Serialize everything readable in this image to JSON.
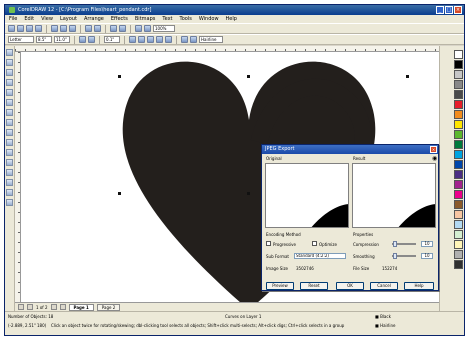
{
  "window": {
    "title": "CorelDRAW 12 - [C:\\Program Files\\heart_pendant.cdr]"
  },
  "menubar": {
    "items": [
      "File",
      "Edit",
      "View",
      "Layout",
      "Arrange",
      "Effects",
      "Bitmaps",
      "Text",
      "Tools",
      "Window",
      "Help"
    ]
  },
  "toolbar": {
    "zoom": "100%",
    "page_size": "Letter",
    "width_value": "8.5\"",
    "height_value": "11.0\"",
    "nudge": "0.1\"",
    "outline": "Hairline"
  },
  "canvas": {
    "fill_color": "#231f1c"
  },
  "export_dialog": {
    "title": "JPEG Export",
    "original_label": "Original",
    "result_label": "Result",
    "encoding_label": "Encoding Method",
    "progressive_label": "Progressive",
    "optimize_label": "Optimize",
    "sub_format_label": "Sub Format",
    "sub_format_value": "Standard (4:2:2)",
    "image_size_label": "Image Size",
    "image_size_value": "3502746",
    "properties_label": "Properties",
    "compression_label": "Compression",
    "compression_value": "10",
    "smoothing_label": "Smoothing",
    "smoothing_value": "10",
    "file_size_label": "File Size",
    "file_size_value": "152274",
    "buttons": {
      "preview": "Preview",
      "reset": "Reset",
      "ok": "OK",
      "cancel": "Cancel",
      "help": "Help"
    }
  },
  "pages": {
    "pager": "1 of 2",
    "tabs": [
      "Page 1",
      "Page 2"
    ]
  },
  "status": {
    "object_count": "Number of Objects: 18",
    "layer": "Curves on Layer 1",
    "coords": "(-2.889, 2.51\" 180)",
    "hint": "Click an object twice for rotating/skewing; dbl-clicking tool selects all objects; Shift+click multi-selects; Alt+click digs; Ctrl+click selects in a group",
    "fill_name": "Black",
    "outline_name": "Hairline"
  },
  "palette": {
    "colors": [
      "#ffffff",
      "#000000",
      "#c6c6c6",
      "#888888",
      "#4a4a4a",
      "#e61e2b",
      "#f28c1e",
      "#ffe600",
      "#5cb82e",
      "#007a3d",
      "#00a3e0",
      "#0047ab",
      "#4b2e83",
      "#a2238e",
      "#ec008c",
      "#8b5a2b",
      "#f7c6a3",
      "#b3d9f2",
      "#d4eed1",
      "#fff5b8",
      "#b0b0b0",
      "#303030"
    ]
  }
}
